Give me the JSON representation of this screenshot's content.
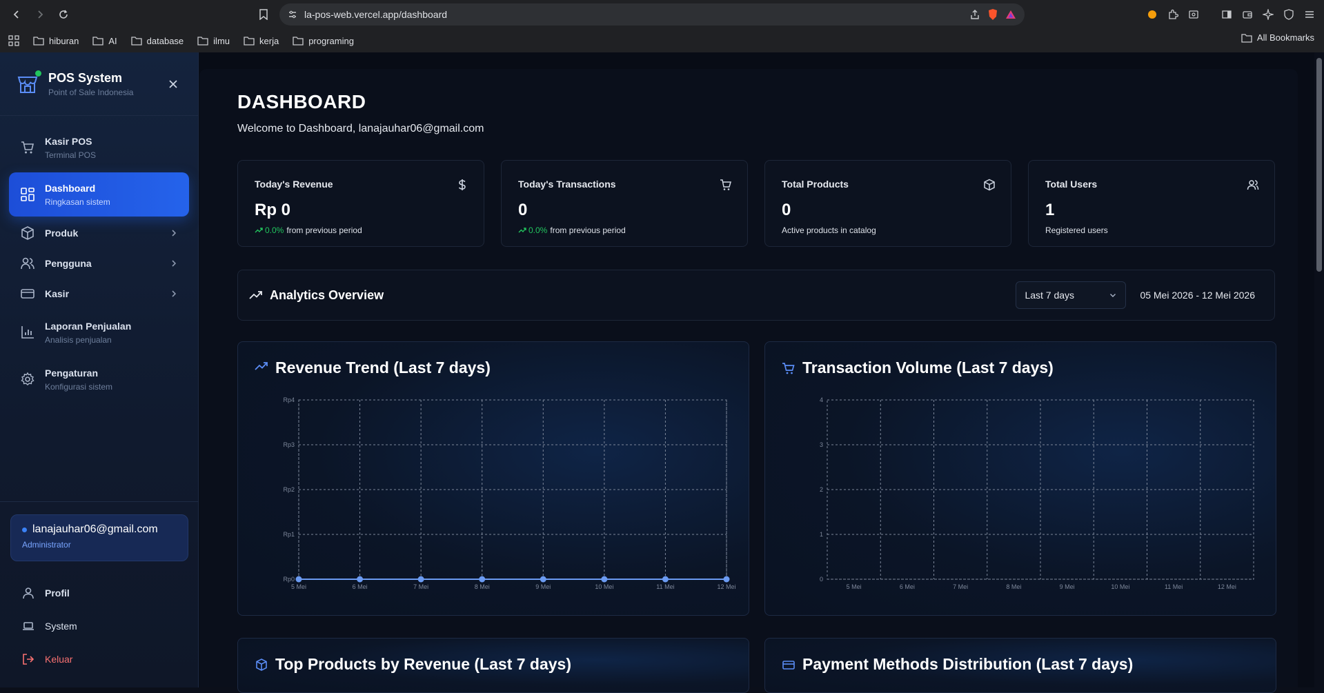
{
  "browser": {
    "url": "la-pos-web.vercel.app/dashboard",
    "bookmarks": [
      "hiburan",
      "AI",
      "database",
      "ilmu",
      "kerja",
      "programing"
    ],
    "all_bookmarks": "All Bookmarks"
  },
  "brand": {
    "title": "POS System",
    "subtitle": "Point of Sale Indonesia"
  },
  "sidebar": {
    "items": [
      {
        "label": "Kasir POS",
        "sub": "Terminal POS",
        "icon": "cart-icon"
      },
      {
        "label": "Dashboard",
        "sub": "Ringkasan sistem",
        "icon": "dashboard-icon",
        "active": true
      },
      {
        "label": "Produk",
        "icon": "package-icon"
      },
      {
        "label": "Pengguna",
        "icon": "users-icon"
      },
      {
        "label": "Kasir",
        "icon": "card-icon"
      },
      {
        "label": "Laporan Penjualan",
        "sub": "Analisis penjualan",
        "icon": "bar-chart-icon"
      },
      {
        "label": "Pengaturan",
        "sub": "Konfigurasi sistem",
        "icon": "gear-icon"
      }
    ],
    "user": {
      "email": "lanajauhar06@gmail.com",
      "role": "Administrator"
    },
    "bottom": {
      "profile": "Profil",
      "system": "System",
      "logout": "Keluar"
    }
  },
  "page": {
    "title": "DASHBOARD",
    "welcome": "Welcome to Dashboard, lanajauhar06@gmail.com"
  },
  "stats": [
    {
      "label": "Today's Revenue",
      "value": "Rp 0",
      "pct": "0.0%",
      "note": "from previous period",
      "icon": "dollar-icon"
    },
    {
      "label": "Today's Transactions",
      "value": "0",
      "pct": "0.0%",
      "note": "from previous period",
      "icon": "cart-icon"
    },
    {
      "label": "Total Products",
      "value": "0",
      "note": "Active products in catalog",
      "icon": "package-icon"
    },
    {
      "label": "Total Users",
      "value": "1",
      "note": "Registered users",
      "icon": "users-icon"
    }
  ],
  "analytics": {
    "title": "Analytics Overview",
    "range": "Last 7 days",
    "date_range": "05 Mei 2026 - 12 Mei 2026"
  },
  "cards": {
    "revenue_title": "Revenue Trend (Last 7 days)",
    "transactions_title": "Transaction Volume (Last 7 days)",
    "top_products_title": "Top Products by Revenue (Last 7 days)",
    "payment_title": "Payment Methods Distribution (Last 7 days)"
  },
  "colors": {
    "accent": "#2563eb",
    "success": "#22c55e",
    "danger": "#f87171",
    "line": "#6b9bf2"
  },
  "chart_data": [
    {
      "type": "line",
      "title": "Revenue Trend (Last 7 days)",
      "categories": [
        "5 Mei",
        "6 Mei",
        "7 Mei",
        "8 Mei",
        "9 Mei",
        "10 Mei",
        "11 Mei",
        "12 Mei"
      ],
      "values": [
        0,
        0,
        0,
        0,
        0,
        0,
        0,
        0
      ],
      "yticks": [
        "Rp0",
        "Rp1",
        "Rp2",
        "Rp3",
        "Rp4"
      ],
      "ylim": [
        0,
        4
      ],
      "grid": true
    },
    {
      "type": "bar",
      "title": "Transaction Volume (Last 7 days)",
      "categories": [
        "5 Mei",
        "6 Mei",
        "7 Mei",
        "8 Mei",
        "9 Mei",
        "10 Mei",
        "11 Mei",
        "12 Mei"
      ],
      "values": [
        0,
        0,
        0,
        0,
        0,
        0,
        0,
        0
      ],
      "yticks": [
        "0",
        "1",
        "2",
        "3",
        "4"
      ],
      "ylim": [
        0,
        4
      ],
      "grid": true
    }
  ]
}
